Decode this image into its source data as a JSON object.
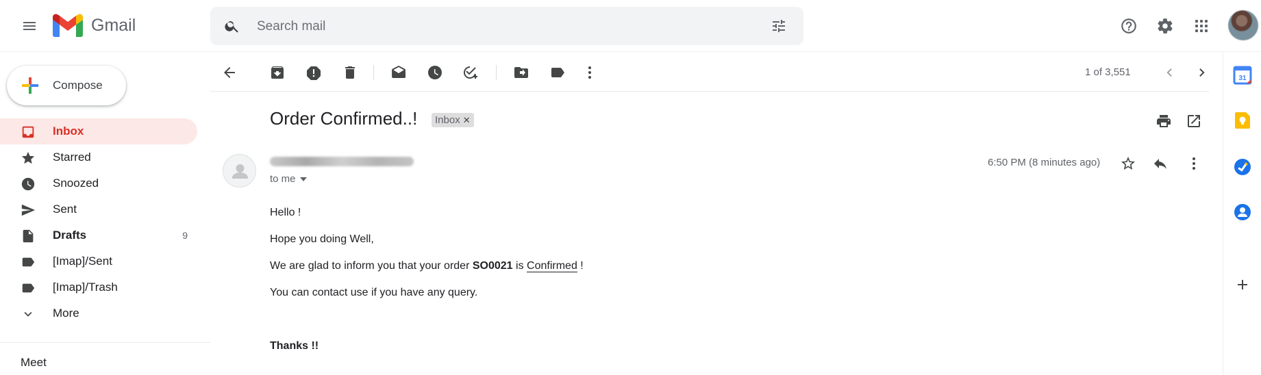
{
  "app": {
    "name": "Gmail"
  },
  "colors": {
    "accent": "#d93025",
    "active_bg": "#fce8e6",
    "search_bg": "#f1f3f4",
    "muted": "#5f6368"
  },
  "search": {
    "placeholder": "Search mail"
  },
  "compose": {
    "label": "Compose"
  },
  "sidebar": {
    "items": [
      {
        "label": "Inbox",
        "icon": "inbox-icon",
        "active": true
      },
      {
        "label": "Starred",
        "icon": "star-icon"
      },
      {
        "label": "Snoozed",
        "icon": "clock-icon"
      },
      {
        "label": "Sent",
        "icon": "send-icon"
      },
      {
        "label": "Drafts",
        "icon": "draft-icon",
        "count": "9"
      },
      {
        "label": "[Imap]/Sent",
        "icon": "label-icon"
      },
      {
        "label": "[Imap]/Trash",
        "icon": "label-icon"
      },
      {
        "label": "More",
        "icon": "chevron-down-icon"
      }
    ],
    "meet_label": "Meet"
  },
  "toolbar": {
    "pager": "1 of 3,551"
  },
  "message": {
    "subject": "Order Confirmed..!",
    "label_badge": "Inbox",
    "to": "to me",
    "time": "6:50 PM (8 minutes ago)",
    "body": {
      "line1": "Hello !",
      "line2": "Hope you doing Well,",
      "line3_pre": "We are glad to inform you that your order ",
      "order_id": "SO0021",
      "line3_mid": " is ",
      "status": "Confirmed",
      "line3_post": " !",
      "line4": "You can contact use if you have any query.",
      "signoff": "Thanks !!"
    }
  }
}
